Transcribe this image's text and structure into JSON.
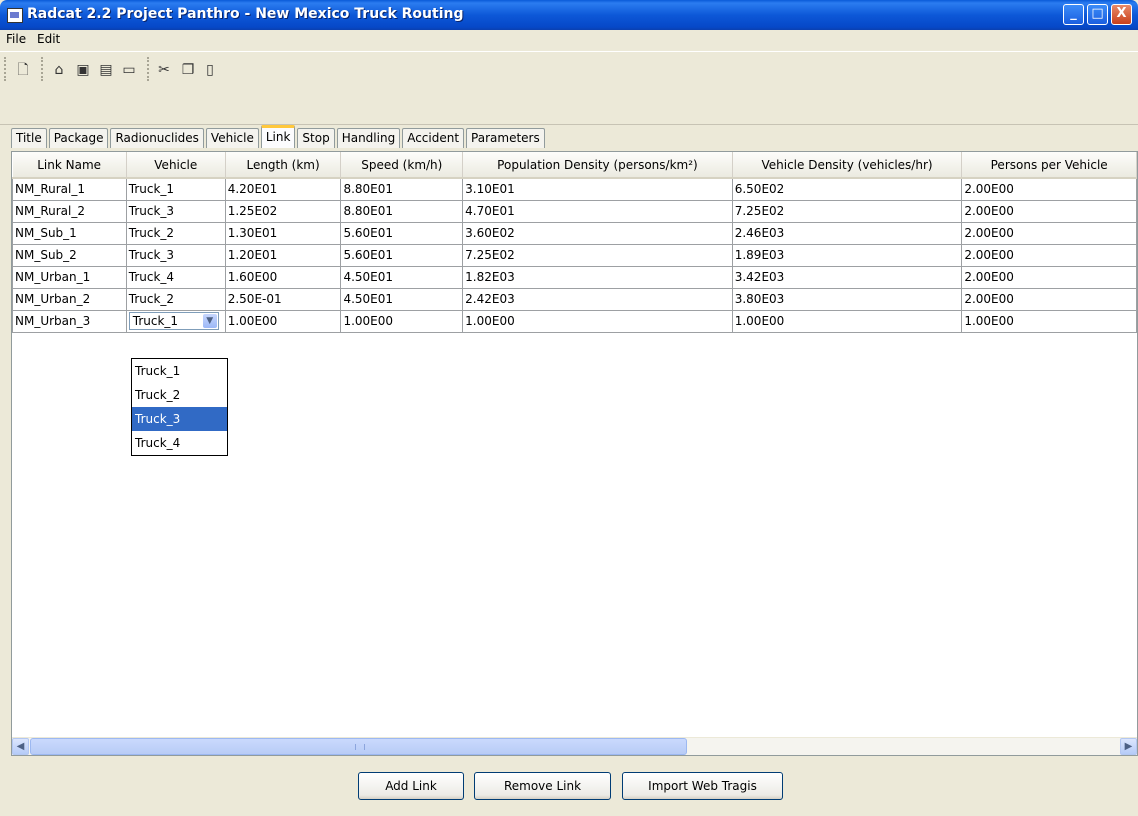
{
  "window": {
    "title": "Radcat 2.2 Project Panthro - New Mexico Truck Routing",
    "controls": {
      "minimize": "_",
      "maximize": "□",
      "close": "X"
    }
  },
  "menu": {
    "items": [
      "File",
      "Edit"
    ]
  },
  "toolbar": {
    "icons": [
      "new-icon",
      "open-icon",
      "save-icon",
      "save-all-icon",
      "print-icon",
      "cut-icon",
      "copy-icon",
      "paste-icon"
    ]
  },
  "tabs": {
    "items": [
      "Title",
      "Package",
      "Radionuclides",
      "Vehicle",
      "Link",
      "Stop",
      "Handling",
      "Accident",
      "Parameters"
    ],
    "active": "Link"
  },
  "table": {
    "columns": [
      "Link Name",
      "Vehicle",
      "Length (km)",
      "Speed (km/h)",
      "Population Density (persons/km²)",
      "Vehicle Density (vehicles/hr)",
      "Persons per Vehicle"
    ],
    "rows": [
      [
        "NM_Rural_1",
        "Truck_1",
        "4.20E01",
        "8.80E01",
        "3.10E01",
        "6.50E02",
        "2.00E00"
      ],
      [
        "NM_Rural_2",
        "Truck_3",
        "1.25E02",
        "8.80E01",
        "4.70E01",
        "7.25E02",
        "2.00E00"
      ],
      [
        "NM_Sub_1",
        "Truck_2",
        "1.30E01",
        "5.60E01",
        "3.60E02",
        "2.46E03",
        "2.00E00"
      ],
      [
        "NM_Sub_2",
        "Truck_3",
        "1.20E01",
        "5.60E01",
        "7.25E02",
        "1.89E03",
        "2.00E00"
      ],
      [
        "NM_Urban_1",
        "Truck_4",
        "1.60E00",
        "4.50E01",
        "1.82E03",
        "3.42E03",
        "2.00E00"
      ],
      [
        "NM_Urban_2",
        "Truck_2",
        "2.50E-01",
        "4.50E01",
        "2.42E03",
        "3.80E03",
        "2.00E00"
      ],
      [
        "NM_Urban_3",
        "Truck_1",
        "1.00E00",
        "1.00E00",
        "1.00E00",
        "1.00E00",
        "1.00E00"
      ]
    ],
    "editing_combo_value": "Truck_1"
  },
  "dropdown": {
    "options": [
      "Truck_1",
      "Truck_2",
      "Truck_3",
      "Truck_4"
    ],
    "highlighted": "Truck_3"
  },
  "buttons": {
    "add_link": "Add Link",
    "remove_link": "Remove Link",
    "import_web_tragis": "Import Web Tragis"
  }
}
